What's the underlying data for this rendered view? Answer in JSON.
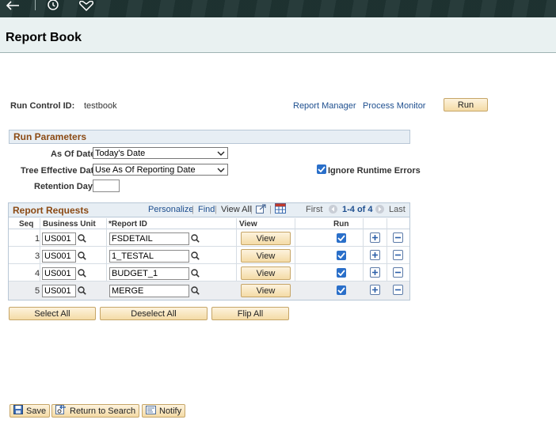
{
  "header": {
    "icons": [
      "back-arrow-icon",
      "history-clock-icon",
      "favorite-heart-icon"
    ],
    "page_title": "Report Book"
  },
  "run_control": {
    "label": "Run Control ID:",
    "value": "testbook",
    "report_manager": "Report Manager",
    "process_monitor": "Process Monitor",
    "run_button": "Run"
  },
  "run_parameters": {
    "title": "Run Parameters",
    "as_of_date_label": "As Of Date",
    "as_of_date_value": "Today's Date",
    "tree_date_label": "Tree Effective Date",
    "tree_date_value": "Use As Of Reporting Date",
    "retention_label": "Retention Days",
    "retention_value": "",
    "ignore_errors_label": "Ignore Runtime Errors",
    "ignore_errors_checked": true
  },
  "report_requests": {
    "title": "Report Requests",
    "personalize": "Personalize",
    "find": "Find",
    "view_all": "View All",
    "first": "First",
    "range": "1-4 of 4",
    "last": "Last",
    "columns": {
      "seq": "Seq",
      "business_unit": "Business Unit",
      "report_id": "*Report ID",
      "view": "View",
      "run": "Run"
    },
    "rows": [
      {
        "seq": "1",
        "business_unit": "US001",
        "report_id": "FSDETAIL",
        "view_label": "View",
        "run": true
      },
      {
        "seq": "3",
        "business_unit": "US001",
        "report_id": "1_TESTAL",
        "view_label": "View",
        "run": true
      },
      {
        "seq": "4",
        "business_unit": "US001",
        "report_id": "BUDGET_1",
        "view_label": "View",
        "run": true
      },
      {
        "seq": "5",
        "business_unit": "US001",
        "report_id": "MERGE",
        "view_label": "View",
        "run": true
      }
    ]
  },
  "bulk_actions": {
    "select_all": "Select All",
    "deselect_all": "Deselect All",
    "flip_all": "Flip All"
  },
  "toolbar": {
    "save": "Save",
    "return_to_search": "Return to Search",
    "notify": "Notify"
  }
}
